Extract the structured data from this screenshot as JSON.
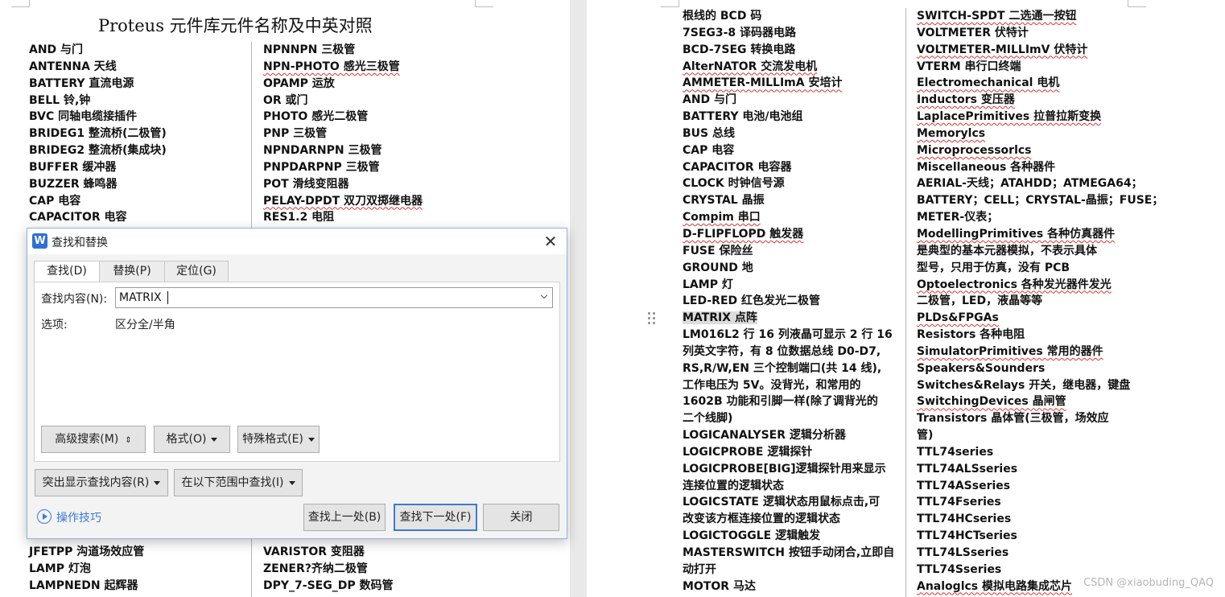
{
  "document": {
    "title": "Proteus 元件库元件名称及中英对照",
    "left_col1": [
      "AND 与门",
      "ANTENNA 天线",
      "BATTERY 直流电源",
      "BELL 铃,钟",
      "BVC 同轴电缆接插件",
      "BRIDEG1 整流桥(二极管)",
      "BRIDEG2 整流桥(集成块)",
      "BUFFER 缓冲器",
      "BUZZER 蜂鸣器",
      "CAP 电容",
      "CAPACITOR 电容"
    ],
    "left_col1_bottom": [
      "JFETPP 沟道场效应管",
      "LAMP 灯泡",
      "LAMPNEDN 起辉器"
    ],
    "left_col2": [
      "NPNNPN 三极管",
      "NPN-PHOTO 感光三极管",
      "OPAMP 运放",
      "OR 或门",
      "PHOTO 感光二极管",
      "PNP 三极管",
      "NPNDARNPN 三极管",
      "PNPDARPNP 三极管",
      "POT 滑线变阻器",
      "PELAY-DPDT 双刀双掷继电器",
      "RES1.2 电阻"
    ],
    "left_col2_bottom": [
      "VARISTOR 变阻器",
      "ZENER?齐纳二极管",
      "DPY_7-SEG_DP 数码管"
    ],
    "right_col1": [
      "根线的 BCD 码",
      "7SEG3-8 译码器电路",
      "BCD-7SEG 转换电路",
      "AlterNATOR 交流发电机",
      "AMMETER-MILLImA 安培计",
      "AND 与门",
      "BATTERY 电池/电池组",
      "BUS 总线",
      "CAP 电容",
      "CAPACITOR 电容器",
      "CLOCK 时钟信号源",
      "CRYSTAL 晶振",
      "Compim 串口",
      "D-FLIPFLOPD 触发器",
      "FUSE 保险丝",
      "GROUND 地",
      "LAMP 灯",
      "LED-RED 红色发光二极管",
      "MATRIX 点阵",
      "LM016L2 行 16 列液晶可显示 2 行 16",
      "列英文字符，有 8 位数据总线 D0-D7,",
      "RS,R/W,EN 三个控制端口(共 14 线),",
      "工作电压为 5V。没背光，和常用的",
      "1602B 功能和引脚一样(除了调背光的",
      "二个线脚)",
      "LOGICANALYSER 逻辑分析器",
      "LOGICPROBE 逻辑探针",
      "LOGICPROBE[BIG]逻辑探针用来显示",
      "连接位置的逻辑状态",
      "LOGICSTATE 逻辑状态用鼠标点击,可",
      "改变该方框连接位置的逻辑状态",
      "LOGICTOGGLE 逻辑触发",
      "MASTERSWITCH 按钮手动闭合,立即自",
      "动打开",
      "MOTOR 马达"
    ],
    "right_col2": [
      "SWITCH-SPDT 二选通一按钮",
      "VOLTMETER 伏特计",
      "VOLTMETER-MILLImV 伏特计",
      "VTERM 串行口终端",
      "Electromechanical 电机",
      "Inductors 变压器",
      "LaplacePrimitives 拉普拉斯变换",
      "Memorylcs",
      "Microprocessorlcs",
      "Miscellaneous 各种器件",
      "AERIAL-天线；ATAHDD；ATMEGA64；",
      "BATTERY；CELL；CRYSTAL-晶振；FUSE；",
      "METER-仪表；",
      "ModellingPrimitives 各种仿真器件",
      "是典型的基本元器模拟，不表示具体",
      "型号，只用于仿真，没有 PCB",
      "Optoelectronics 各种发光器件发光",
      "二极管，LED，液晶等等",
      "PLDs&FPGAs",
      "Resistors 各种电阻",
      "SimulatorPrimitives 常用的器件",
      "Speakers&Sounders",
      "Switches&Relays 开关，继电器，键盘",
      "SwitchingDevices 晶闸管",
      "Transistors 晶体管(三极管，场效应",
      "管)",
      "TTL74series",
      "TTL74ALSseries",
      "TTL74ASseries",
      "TTL74Fseries",
      "TTL74HCseries",
      "TTL74HCTseries",
      "TTL74LSseries",
      "TTL74Sseries",
      "Analoglcs 模拟电路集成芯片"
    ],
    "watermark": "CSDN @xiaobuding_QAQ"
  },
  "dialog": {
    "title": "查找和替换",
    "app_icon_letter": "W",
    "close_glyph": "✕",
    "tabs": [
      "查找(D)",
      "替换(P)",
      "定位(G)"
    ],
    "find_label": "查找内容(N):",
    "find_value": "MATRIX",
    "options_label": "选项:",
    "options_value": "区分全/半角",
    "advanced_button": "高级搜索(M)",
    "format_button": "格式(O)",
    "special_button": "特殊格式(E)",
    "highlight_button": "突出显示查找内容(R)",
    "scope_button": "在以下范围中查找(I)",
    "tips_link": "操作技巧",
    "prev_button": "查找上一处(B)",
    "next_button": "查找下一处(F)",
    "close_button": "关闭"
  },
  "colors": {
    "accent": "#3a7bd5",
    "spell_underline": "#d33",
    "match_highlight": "#dcdcdc"
  }
}
